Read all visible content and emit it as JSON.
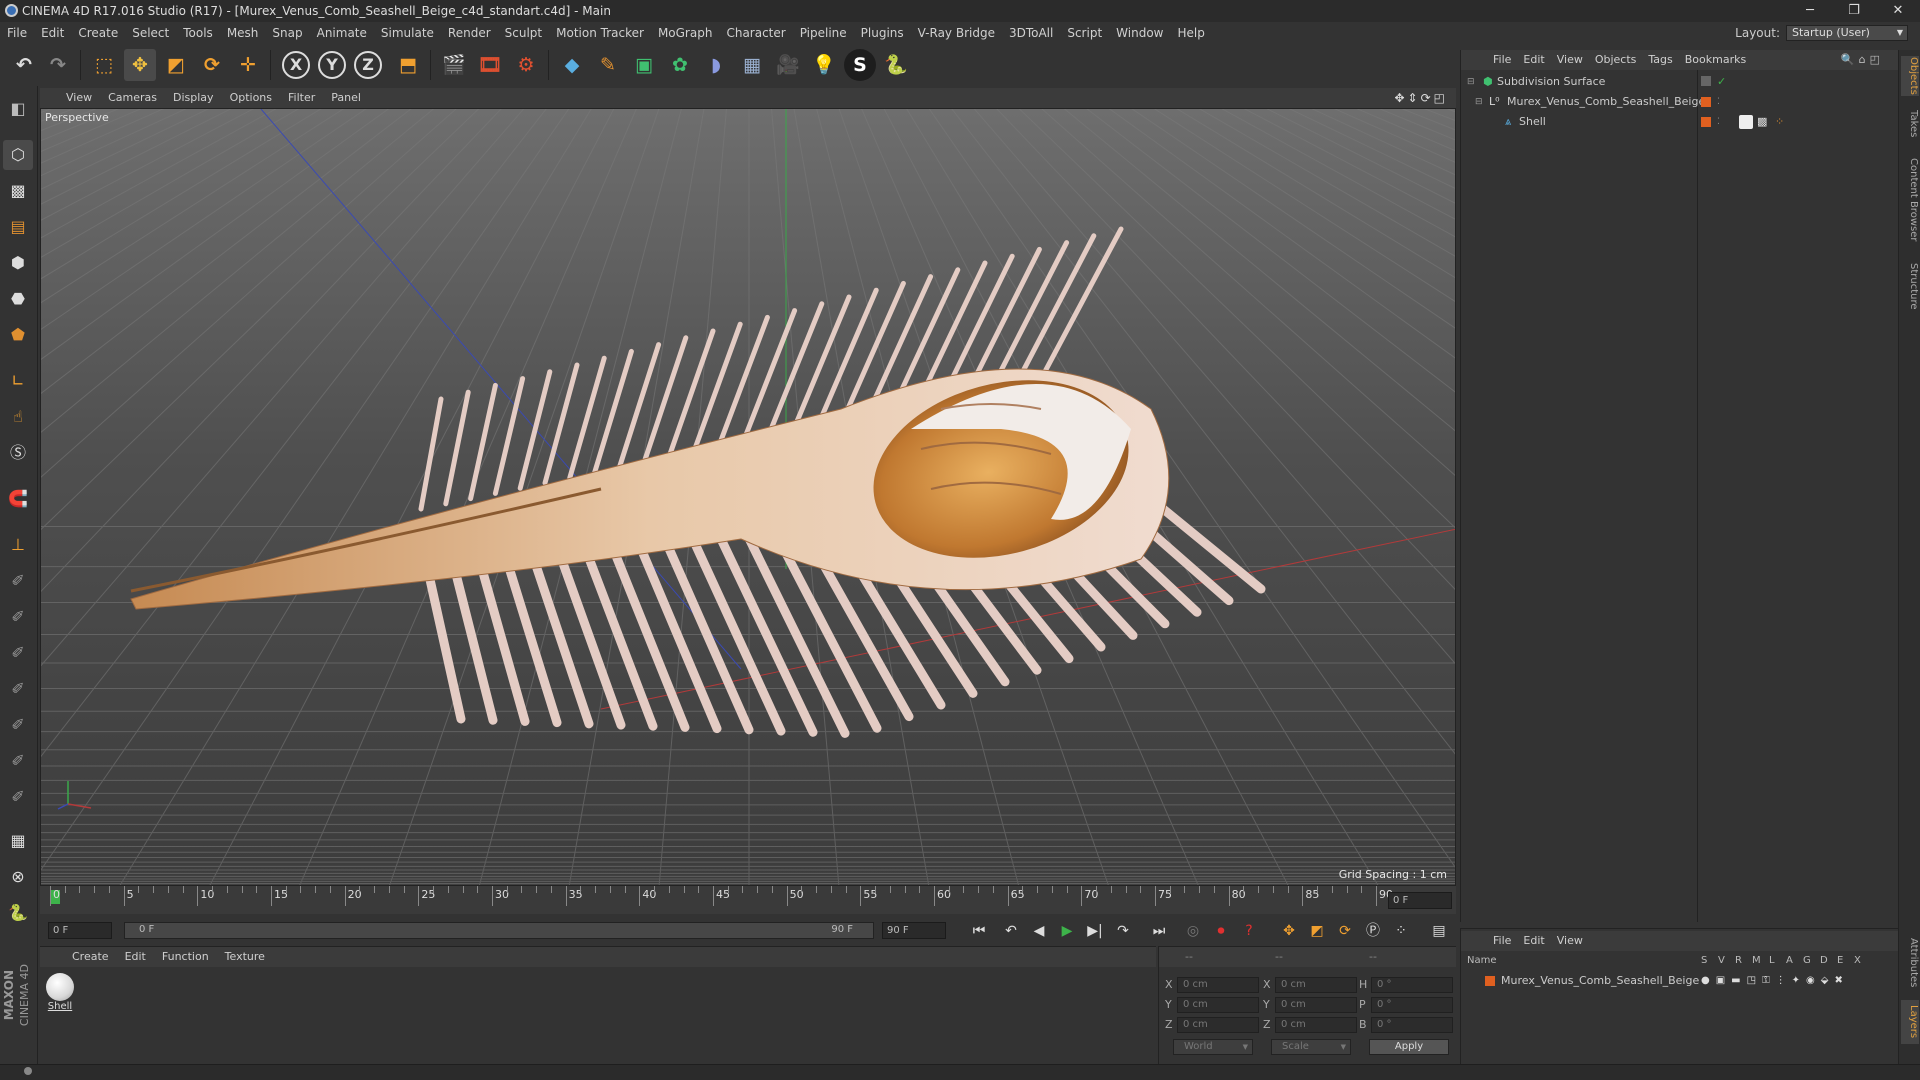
{
  "window": {
    "title": "CINEMA 4D R17.016 Studio (R17) - [Murex_Venus_Comb_Seashell_Beige_c4d_standart.c4d] - Main",
    "minimize": "─",
    "restore": "❐",
    "close": "✕"
  },
  "menubar": {
    "items": [
      "File",
      "Edit",
      "Create",
      "Select",
      "Tools",
      "Mesh",
      "Snap",
      "Animate",
      "Simulate",
      "Render",
      "Sculpt",
      "Motion Tracker",
      "MoGraph",
      "Character",
      "Pipeline",
      "Plugins",
      "V-Ray Bridge",
      "3DToAll",
      "Script",
      "Window",
      "Help"
    ],
    "layout_label": "Layout:",
    "layout_value": "Startup (User)"
  },
  "toolbar": {
    "undo": "↶",
    "redo": "↷",
    "axis_x": "X",
    "axis_y": "Y",
    "axis_z": "Z"
  },
  "viewport": {
    "menu": [
      "View",
      "Cameras",
      "Display",
      "Options",
      "Filter",
      "Panel"
    ],
    "label": "Perspective",
    "grid_spacing": "Grid Spacing : 1 cm",
    "colors": {
      "x_axis": "#b33a3a",
      "y_axis": "#3aa84a",
      "z_axis": "#3a4ab3"
    }
  },
  "timeline": {
    "ticks": [
      "0",
      "5",
      "10",
      "15",
      "20",
      "25",
      "30",
      "35",
      "40",
      "45",
      "50",
      "55",
      "60",
      "65",
      "70",
      "75",
      "80",
      "85",
      "90"
    ],
    "frame_field": "0 F",
    "current_frame": "0 F",
    "range_start": "0 F",
    "range_end": "90 F",
    "max_frame": "90 F"
  },
  "materials": {
    "menu": [
      "Create",
      "Edit",
      "Function",
      "Texture"
    ],
    "items": [
      {
        "name": "Shell"
      }
    ],
    "brand_top": "MAXON",
    "brand_bottom": "CINEMA 4D"
  },
  "coordinates": {
    "header": [
      "--",
      "--",
      "--"
    ],
    "rows": [
      {
        "axis": "X",
        "pos": "0 cm",
        "axis2": "X",
        "size": "0 cm",
        "rot_label": "H",
        "rot": "0 °"
      },
      {
        "axis": "Y",
        "pos": "0 cm",
        "axis2": "Y",
        "size": "0 cm",
        "rot_label": "P",
        "rot": "0 °"
      },
      {
        "axis": "Z",
        "pos": "0 cm",
        "axis2": "Z",
        "size": "0 cm",
        "rot_label": "B",
        "rot": "0 °"
      }
    ],
    "space_select": "World",
    "mode_select": "Scale",
    "apply": "Apply"
  },
  "objects_panel": {
    "menu": [
      "File",
      "Edit",
      "View",
      "Objects",
      "Tags",
      "Bookmarks"
    ],
    "tree": [
      {
        "name": "Subdivision Surface",
        "level": 0
      },
      {
        "name": "Murex_Venus_Comb_Seashell_Beige",
        "level": 1
      },
      {
        "name": "Shell",
        "level": 2
      }
    ]
  },
  "layers_panel": {
    "menu": [
      "File",
      "Edit",
      "View"
    ],
    "columns": [
      "Name",
      "S",
      "V",
      "R",
      "M",
      "L",
      "A",
      "G",
      "D",
      "E",
      "X"
    ],
    "rows": [
      {
        "name": "Murex_Venus_Comb_Seashell_Beige"
      }
    ]
  },
  "side_tabs": [
    "Objects",
    "Takes",
    "Content Browser",
    "Structure",
    "Attributes",
    "Layers"
  ]
}
